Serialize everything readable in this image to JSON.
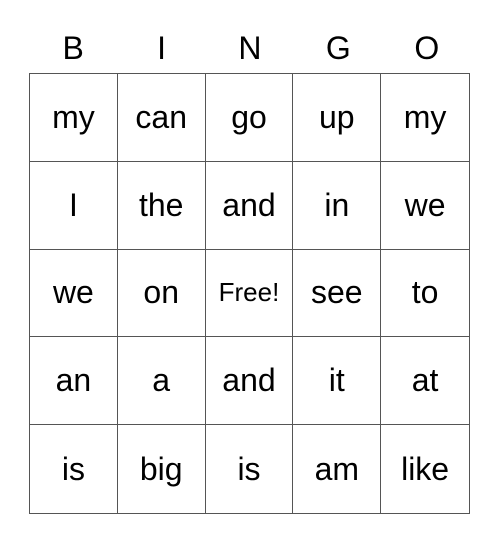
{
  "header": [
    "B",
    "I",
    "N",
    "G",
    "O"
  ],
  "cells": [
    [
      "my",
      "can",
      "go",
      "up",
      "my"
    ],
    [
      "I",
      "the",
      "and",
      "in",
      "we"
    ],
    [
      "we",
      "on",
      "Free!",
      "see",
      "to"
    ],
    [
      "an",
      "a",
      "and",
      "it",
      "at"
    ],
    [
      "is",
      "big",
      "is",
      "am",
      "like"
    ]
  ]
}
